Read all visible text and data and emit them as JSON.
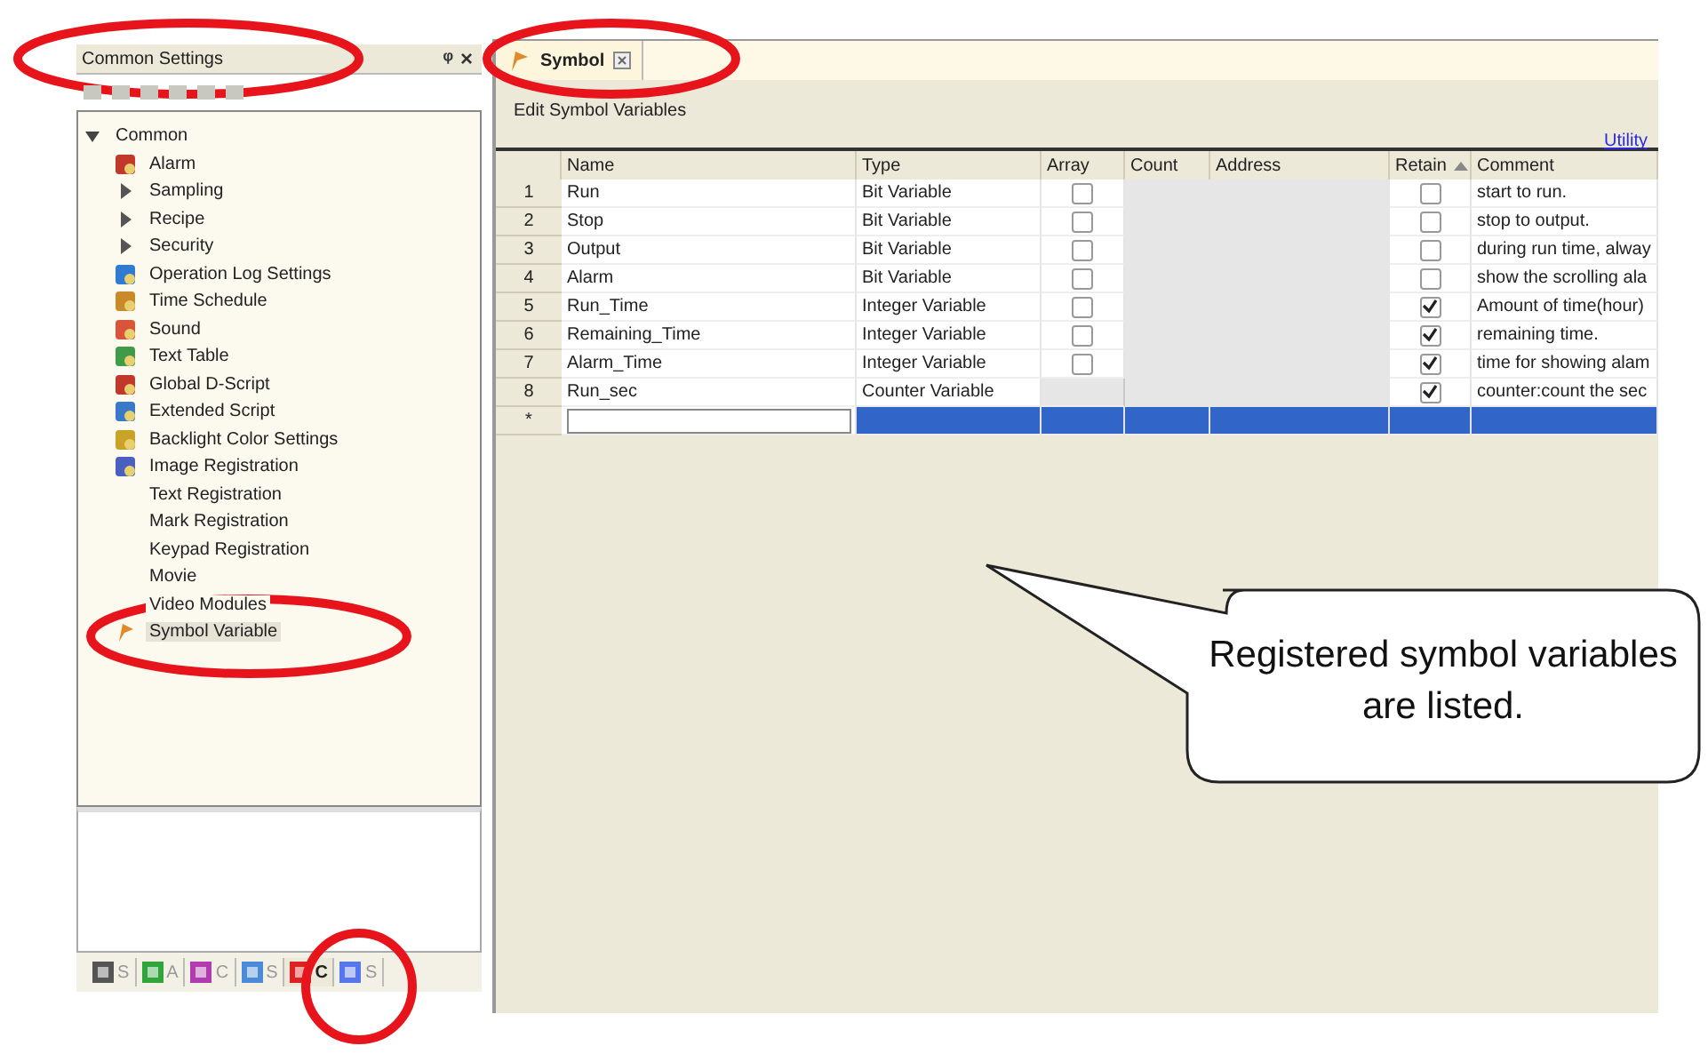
{
  "left_panel": {
    "title": "Common Settings",
    "pin": "ᵠ",
    "close": "×",
    "tree": {
      "label": "Common",
      "expanded": true,
      "children": [
        {
          "label": "Alarm",
          "kind": "icon",
          "selected": false
        },
        {
          "label": "Sampling",
          "kind": "branch",
          "expanded": false,
          "selected": false
        },
        {
          "label": "Recipe",
          "kind": "branch",
          "expanded": false,
          "selected": false
        },
        {
          "label": "Security",
          "kind": "branch",
          "expanded": false,
          "selected": false
        },
        {
          "label": "Operation Log Settings",
          "kind": "icon",
          "selected": false
        },
        {
          "label": "Time Schedule",
          "kind": "icon",
          "selected": false
        },
        {
          "label": "Sound",
          "kind": "icon",
          "selected": false
        },
        {
          "label": "Text Table",
          "kind": "icon",
          "selected": false
        },
        {
          "label": "Global D-Script",
          "kind": "icon",
          "selected": false
        },
        {
          "label": "Extended Script",
          "kind": "icon",
          "selected": false
        },
        {
          "label": "Backlight Color Settings",
          "kind": "icon",
          "selected": false
        },
        {
          "label": "Image Registration",
          "kind": "icon",
          "selected": false
        },
        {
          "label": "Text Registration",
          "kind": "text",
          "selected": false
        },
        {
          "label": "Mark Registration",
          "kind": "text",
          "selected": false
        },
        {
          "label": "Keypad Registration",
          "kind": "text",
          "selected": false
        },
        {
          "label": "Movie",
          "kind": "text",
          "selected": false
        },
        {
          "label": "Video Modules",
          "kind": "text",
          "selected": false
        },
        {
          "label": "Symbol Variable",
          "kind": "symbol",
          "selected": true
        }
      ]
    },
    "bottom_tabs": [
      {
        "label": "S",
        "selected": false
      },
      {
        "label": "A",
        "selected": false
      },
      {
        "label": "C",
        "selected": false
      },
      {
        "label": "S",
        "selected": false
      },
      {
        "label": "C",
        "selected": true
      },
      {
        "label": "S",
        "selected": false
      }
    ]
  },
  "editor": {
    "tab": {
      "label": "Symbol"
    },
    "heading": "Edit Symbol Variables",
    "utility_link": "Utility",
    "columns": [
      "Name",
      "Type",
      "Array",
      "Count",
      "Address",
      "Retain",
      "Comment"
    ],
    "rows": [
      {
        "number": "1",
        "name": "Run",
        "type": "Bit Variable",
        "array_available": true,
        "array": false,
        "retain": false,
        "comment": "start to run."
      },
      {
        "number": "2",
        "name": "Stop",
        "type": "Bit Variable",
        "array_available": true,
        "array": false,
        "retain": false,
        "comment": "stop to output."
      },
      {
        "number": "3",
        "name": "Output",
        "type": "Bit Variable",
        "array_available": true,
        "array": false,
        "retain": false,
        "comment": "during run time, alway"
      },
      {
        "number": "4",
        "name": "Alarm",
        "type": "Bit Variable",
        "array_available": true,
        "array": false,
        "retain": false,
        "comment": "show the scrolling ala"
      },
      {
        "number": "5",
        "name": "Run_Time",
        "type": "Integer Variable",
        "array_available": true,
        "array": false,
        "retain": true,
        "comment": "Amount of time(hour)"
      },
      {
        "number": "6",
        "name": "Remaining_Time",
        "type": "Integer Variable",
        "array_available": true,
        "array": false,
        "retain": true,
        "comment": "remaining time."
      },
      {
        "number": "7",
        "name": "Alarm_Time",
        "type": "Integer Variable",
        "array_available": true,
        "array": false,
        "retain": true,
        "comment": "time for showing alam"
      },
      {
        "number": "8",
        "name": "Run_sec",
        "type": "Counter Variable",
        "array_available": false,
        "array": false,
        "retain": true,
        "comment": "counter:count the sec"
      }
    ],
    "new_row": {
      "marker": "*",
      "selected": true
    }
  },
  "callout": {
    "text": "Registered symbol variables are listed."
  }
}
